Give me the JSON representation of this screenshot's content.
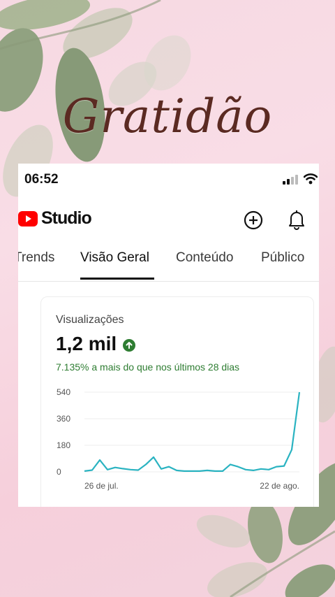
{
  "overlay": {
    "title": "Gratidão"
  },
  "status": {
    "time": "06:52"
  },
  "app": {
    "name": "Studio"
  },
  "tabs": [
    {
      "label": "Trends",
      "active": false
    },
    {
      "label": "Visão Geral",
      "active": true
    },
    {
      "label": "Conteúdo",
      "active": false
    },
    {
      "label": "Público",
      "active": false
    }
  ],
  "card": {
    "title": "Visualizações",
    "value": "1,2 mil",
    "delta": "7.135% a mais do que nos últimos 28 dias"
  },
  "colors": {
    "accent_red": "#ff0000",
    "line": "#2ab3c1",
    "positive": "#2e7d32"
  },
  "chart_data": {
    "type": "line",
    "y_ticks": [
      "540",
      "360",
      "180",
      "0"
    ],
    "ylim": [
      0,
      540
    ],
    "x_labels": [
      "26 de jul.",
      "22 de ago."
    ],
    "series": [
      {
        "values": [
          5,
          12,
          80,
          15,
          30,
          22,
          15,
          12,
          50,
          100,
          20,
          35,
          10,
          5,
          5,
          5,
          10,
          5,
          5,
          50,
          35,
          15,
          10,
          20,
          15,
          35,
          40,
          150,
          540
        ]
      }
    ]
  }
}
